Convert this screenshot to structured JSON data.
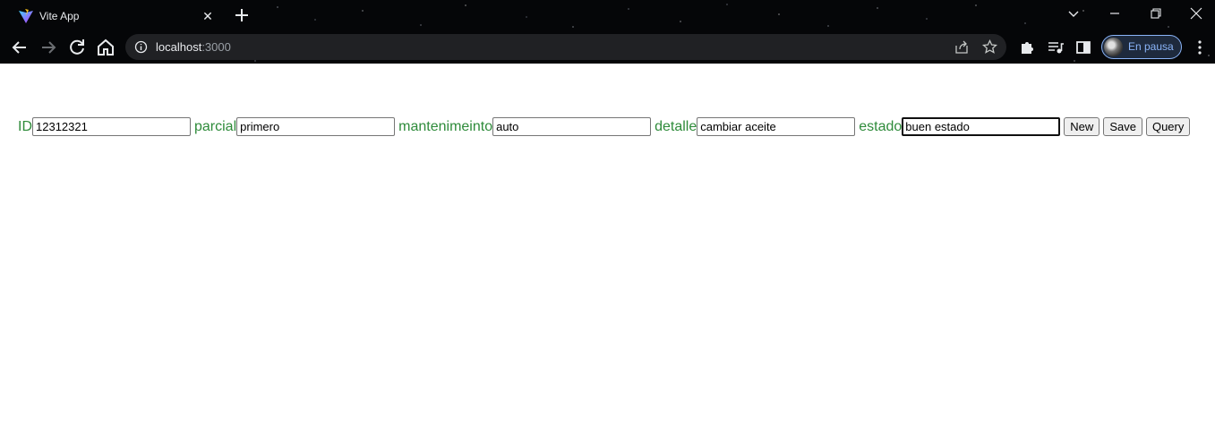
{
  "browser": {
    "tab_title": "Vite App",
    "url_host": "localhost",
    "url_port": ":3000",
    "profile_label": "En pausa"
  },
  "form": {
    "fields": [
      {
        "label": "ID",
        "value": "12312321"
      },
      {
        "label": "parcial",
        "value": "primero"
      },
      {
        "label": "mantenimeinto",
        "value": "auto"
      },
      {
        "label": "detalle",
        "value": "cambiar aceite"
      },
      {
        "label": "estado",
        "value": "buen estado"
      }
    ],
    "buttons": {
      "new_label": "New",
      "save_label": "Save",
      "query_label": "Query"
    }
  },
  "colors": {
    "label_color": "#2e8b3a",
    "chrome_bg": "#050608"
  }
}
